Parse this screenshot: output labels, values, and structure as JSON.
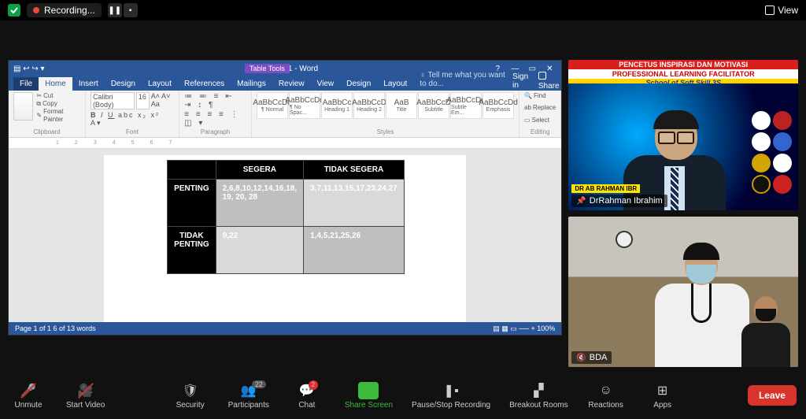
{
  "topbar": {
    "recording_label": "Recording...",
    "view_label": "View"
  },
  "word": {
    "doc_title": "Document1 - Word",
    "table_tools": "Table Tools",
    "tabs": [
      "File",
      "Home",
      "Insert",
      "Design",
      "Layout",
      "References",
      "Mailings",
      "Review",
      "View"
    ],
    "context_tabs": [
      "Design",
      "Layout"
    ],
    "tell_me": "Tell me what you want to do...",
    "sign_in": "Sign in",
    "share": "Share",
    "clipboard": {
      "cut": "Cut",
      "copy": "Copy",
      "fmt": "Format Painter",
      "group": "Clipboard"
    },
    "font": {
      "name": "Calibri (Body)",
      "size": "16",
      "group": "Font"
    },
    "paragraph": {
      "group": "Paragraph"
    },
    "styles": {
      "group": "Styles",
      "items": [
        {
          "sample": "AaBbCcDd",
          "name": "¶ Normal"
        },
        {
          "sample": "AaBbCcDd",
          "name": "¶ No Spac..."
        },
        {
          "sample": "AaBbCc",
          "name": "Heading 1"
        },
        {
          "sample": "AaBbCcD",
          "name": "Heading 2"
        },
        {
          "sample": "AaB",
          "name": "Title"
        },
        {
          "sample": "AaBbCcD",
          "name": "Subtitle"
        },
        {
          "sample": "AaBbCcDd",
          "name": "Subtle Em..."
        },
        {
          "sample": "AaBbCcDd",
          "name": "Emphasis"
        }
      ]
    },
    "editing": {
      "find": "Find",
      "replace": "Replace",
      "select": "Select",
      "group": "Editing"
    },
    "status_left": "Page 1 of 1     6 of 13 words",
    "status_right": "100%",
    "table": {
      "col1_header": "SEGERA",
      "col2_header": "TIDAK SEGERA",
      "row1_header": "PENTING",
      "row2_header": "TIDAK PENTING",
      "r1c1": "2,6,8,10,12,14,16,18, 19, 20, 28",
      "r1c2": "3,7,11,13,15,17,23,24,27",
      "r2c1": "9,22",
      "r2c2": "1,4,5,21,25,26"
    }
  },
  "participants": {
    "p1": {
      "banner1": "PENCETUS INSPIRASI DAN MOTIVASI",
      "banner2": "PROFESSIONAL LEARNING FACILITATOR",
      "banner3": "School of Soft Skill 3S",
      "tape": "DR AB RAHMAN IBR",
      "name": "DrRahman Ibrahim"
    },
    "p2": {
      "name": "BDA"
    }
  },
  "controls": {
    "unmute": "Unmute",
    "start_video": "Start Video",
    "security": "Security",
    "participants": "Participants",
    "participants_count": "22",
    "chat": "Chat",
    "chat_badge": "2",
    "share": "Share Screen",
    "record": "Pause/Stop Recording",
    "breakout": "Breakout Rooms",
    "reactions": "Reactions",
    "apps": "Apps",
    "leave": "Leave"
  }
}
